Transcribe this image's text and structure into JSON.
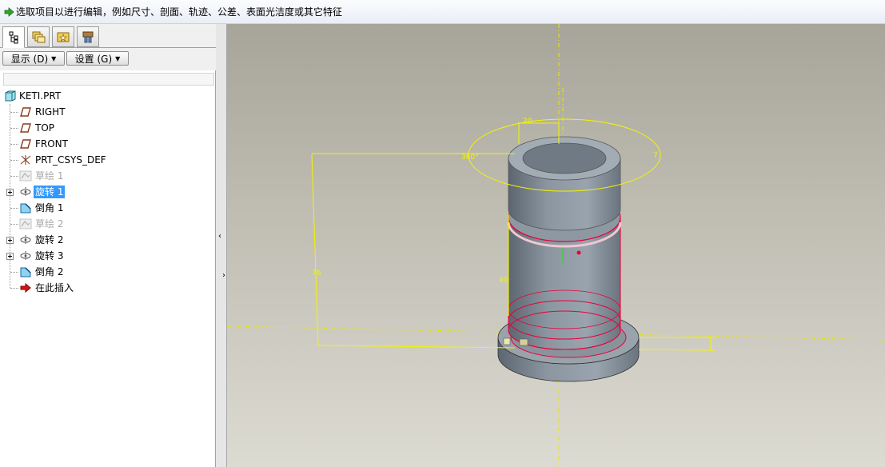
{
  "message_bar": {
    "text": "选取项目以进行编辑，例如尺寸、剖面、轨迹、公差、表面光洁度或其它特征",
    "icon": "green-arrow-icon"
  },
  "tabs": [
    {
      "name": "model-tree",
      "icon": "tree-icon",
      "active": true
    },
    {
      "name": "folder-browser",
      "icon": "folder-browser-icon"
    },
    {
      "name": "favorites",
      "icon": "favorites-icon"
    },
    {
      "name": "connections",
      "icon": "connections-icon"
    }
  ],
  "toolbar": {
    "show_label": "显示 (D)",
    "settings_label": "设置 (G)"
  },
  "tree": {
    "root": "KETI.PRT",
    "items": [
      {
        "label": "RIGHT",
        "icon": "datum-plane-icon"
      },
      {
        "label": "TOP",
        "icon": "datum-plane-icon"
      },
      {
        "label": "FRONT",
        "icon": "datum-plane-icon"
      },
      {
        "label": "PRT_CSYS_DEF",
        "icon": "csys-icon"
      },
      {
        "label": "草绘 1",
        "icon": "sketch-icon",
        "dim": true
      },
      {
        "label": "旋转 1",
        "icon": "revolve-icon",
        "expandable": true,
        "selected": true
      },
      {
        "label": "倒角 1",
        "icon": "chamfer-icon"
      },
      {
        "label": "草绘 2",
        "icon": "sketch-icon",
        "dim": true
      },
      {
        "label": "旋转 2",
        "icon": "revolve-icon",
        "expandable": true
      },
      {
        "label": "旋转 3",
        "icon": "revolve-icon",
        "expandable": true
      },
      {
        "label": "倒角 2",
        "icon": "chamfer-icon"
      },
      {
        "label": "在此插入",
        "icon": "insert-here-icon"
      }
    ]
  },
  "viewport": {
    "dimensions": {
      "d20": "20",
      "d360": "360°",
      "d76": "76",
      "d40": "40",
      "d7": "7"
    },
    "colors": {
      "dimension": "#f4f400",
      "highlight": "#e8003a",
      "model": "#7e8892"
    }
  }
}
